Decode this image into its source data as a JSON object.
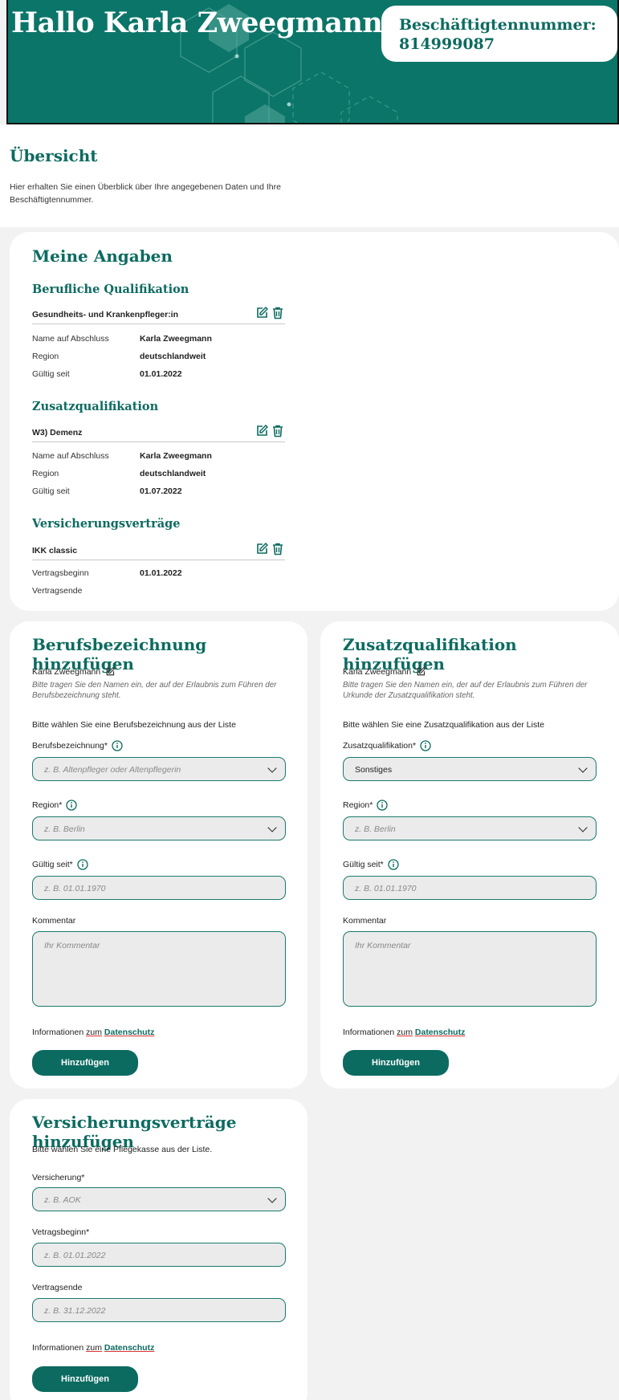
{
  "header": {
    "greeting": "Hallo Karla Zweegmann",
    "badge_label": "Beschäftigtennummer:",
    "badge_value": "814999087"
  },
  "overview": {
    "title": "Übersicht",
    "text": "Hier erhalten Sie einen Überblick über Ihre angegebenen Daten und Ihre Beschäftigtennummer."
  },
  "my_data": {
    "title": "Meine Angaben",
    "prof_title": "Berufliche Qualifikation",
    "prof": {
      "name": "Gesundheits- und Krankenpfleger:in",
      "k1": "Name auf Abschluss",
      "v1": "Karla Zweegmann",
      "k2": "Region",
      "v2": "deutschlandweit",
      "k3": "Gültig seit",
      "v3": "01.01.2022"
    },
    "extra_title": "Zusatzqualifikation",
    "extra": {
      "name": "W3) Demenz",
      "k1": "Name auf Abschluss",
      "v1": "Karla Zweegmann",
      "k2": "Region",
      "v2": "deutschlandweit",
      "k3": "Gültig seit",
      "v3": "01.07.2022"
    },
    "ins_title": "Versicherungsverträge",
    "ins": {
      "name": "IKK classic",
      "k1": "Vertragsbeginn",
      "v1": "01.01.2022",
      "k2": "Vertragsende"
    }
  },
  "form_job": {
    "title": "Berufsbezeichnung hinzufügen",
    "name": "Karla Zweegmann",
    "hint": "Bitte tragen Sie den Namen ein, der auf der Erlaubnis zum Führen der Berufsbezeichnung steht.",
    "instruction": "Bitte wählen Sie eine Berufsbezeichnung aus der Liste",
    "job_label": "Berufsbezeichnung*",
    "job_placeholder": "z. B. Altenpfleger oder Altenpflegerin",
    "region_label": "Region*",
    "region_placeholder": "z. B. Berlin",
    "valid_label": "Gültig seit*",
    "valid_placeholder": "z. B. 01.01.1970",
    "comment_label": "Kommentar",
    "comment_placeholder": "Ihr Kommentar",
    "privacy_prefix": "Informationen ",
    "privacy_zum": "zum",
    "privacy_link": "Datenschutz",
    "button": "Hinzufügen"
  },
  "form_extra": {
    "title": "Zusatzqualifikation hinzufügen",
    "name": "Karla Zweegmann",
    "hint": "Bitte tragen Sie den Namen ein, der auf der Erlaubnis zum Führen der Urkunde der Zusatzqualifikation steht.",
    "instruction": "Bitte wählen Sie eine Zusatzqualifikation aus der Liste",
    "qual_label": "Zusatzqualifikation*",
    "qual_value": "Sonstiges",
    "region_label": "Region*",
    "region_placeholder": "z. B. Berlin",
    "valid_label": "Gültig seit*",
    "valid_placeholder": "z. B. 01.01.1970",
    "comment_label": "Kommentar",
    "comment_placeholder": "Ihr Kommentar",
    "privacy_prefix": "Informationen ",
    "privacy_zum": "zum",
    "privacy_link": "Datenschutz",
    "button": "Hinzufügen"
  },
  "form_ins": {
    "title": "Versicherungsverträge hinzufügen",
    "instruction": "Bitte wählen Sie eine Pflegekasse aus der Liste.",
    "ins_label": "Versicherung*",
    "ins_placeholder": "z. B. AOK",
    "start_label": "Vetragsbeginn*",
    "start_placeholder": "z. B. 01.01.2022",
    "end_label": "Vertragsende",
    "end_placeholder": "z. B. 31.12.2022",
    "privacy_prefix": "Informationen ",
    "privacy_zum": "zum",
    "privacy_link": "Datenschutz",
    "button": "Hinzufügen"
  }
}
